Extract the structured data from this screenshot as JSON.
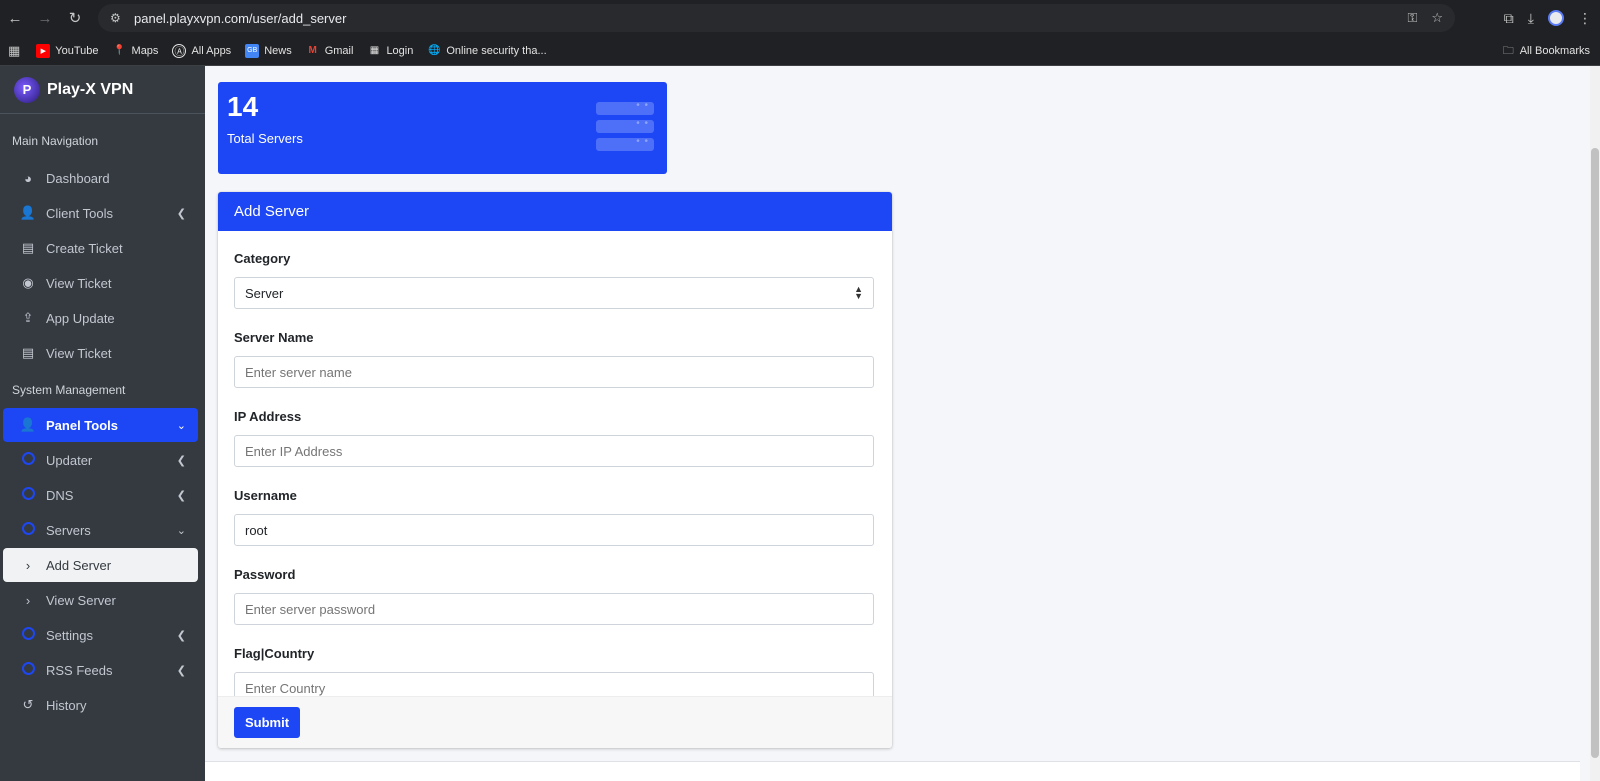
{
  "browser": {
    "url": "panel.playxvpn.com/user/add_server",
    "bookmarks": [
      {
        "label": "YouTube",
        "icon": "youtube-icon",
        "color": "#ff0000"
      },
      {
        "label": "Maps",
        "icon": "maps-icon",
        "color": "#34a853"
      },
      {
        "label": "All Apps",
        "icon": "apps-icon",
        "color": "#e3e3e3"
      },
      {
        "label": "News",
        "icon": "news-icon",
        "color": "#4285f4"
      },
      {
        "label": "Gmail",
        "icon": "gmail-icon",
        "color": "#ea4335"
      },
      {
        "label": "Login",
        "icon": "login-icon",
        "color": "#e3e3e3"
      },
      {
        "label": "Online security tha...",
        "icon": "globe-icon",
        "color": "#e3e3e3"
      }
    ],
    "all_bookmarks": "All Bookmarks"
  },
  "sidebar": {
    "brand": "Play-X VPN",
    "main_header": "Main Navigation",
    "main_items": [
      {
        "label": "Dashboard",
        "icon": "dashboard-icon"
      },
      {
        "label": "Client Tools",
        "icon": "user-icon",
        "caret": true
      },
      {
        "label": "Create Ticket",
        "icon": "ticket-icon"
      },
      {
        "label": "View Ticket",
        "icon": "eye-icon"
      },
      {
        "label": "App Update",
        "icon": "upload-icon"
      },
      {
        "label": "View Ticket",
        "icon": "ticket-icon"
      }
    ],
    "system_header": "System Management",
    "panel_tools": "Panel Tools",
    "system_items": [
      {
        "label": "Updater"
      },
      {
        "label": "DNS"
      },
      {
        "label": "Servers"
      }
    ],
    "server_sub": [
      {
        "label": "Add Server"
      },
      {
        "label": "View Server"
      }
    ],
    "more_items": [
      {
        "label": "Settings"
      },
      {
        "label": "RSS Feeds"
      }
    ],
    "history": "History"
  },
  "stat": {
    "value": "14",
    "label": "Total Servers"
  },
  "form": {
    "title": "Add Server",
    "category_label": "Category",
    "category_value": "Server",
    "server_name_label": "Server Name",
    "server_name_placeholder": "Enter server name",
    "ip_label": "IP Address",
    "ip_placeholder": "Enter IP Address",
    "username_label": "Username",
    "username_value": "root",
    "password_label": "Password",
    "password_placeholder": "Enter server password",
    "country_label": "Flag|Country",
    "country_placeholder": "Enter Country",
    "submit": "Submit"
  },
  "colors": {
    "accent": "#1d47f5",
    "sidebar_bg": "#343a40"
  }
}
